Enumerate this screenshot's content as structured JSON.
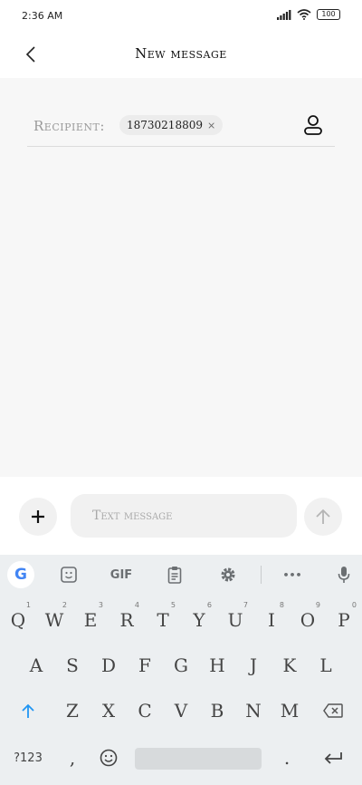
{
  "status_bar": {
    "time": "2:36 AM",
    "battery": "100"
  },
  "header": {
    "title": "New message"
  },
  "recipient": {
    "label": "Recipient:",
    "chip_text": "18730218809",
    "chip_remove": "×"
  },
  "compose": {
    "placeholder": "Text message"
  },
  "keyboard": {
    "toolbar": {
      "google": "G",
      "gif": "GIF",
      "more": "•••"
    },
    "row1": [
      {
        "k": "Q",
        "h": "1"
      },
      {
        "k": "W",
        "h": "2"
      },
      {
        "k": "E",
        "h": "3"
      },
      {
        "k": "R",
        "h": "4"
      },
      {
        "k": "T",
        "h": "5"
      },
      {
        "k": "Y",
        "h": "6"
      },
      {
        "k": "U",
        "h": "7"
      },
      {
        "k": "I",
        "h": "8"
      },
      {
        "k": "O",
        "h": "9"
      },
      {
        "k": "P",
        "h": "0"
      }
    ],
    "row2": [
      "A",
      "S",
      "D",
      "F",
      "G",
      "H",
      "J",
      "K",
      "L"
    ],
    "row3": [
      "Z",
      "X",
      "C",
      "V",
      "B",
      "N",
      "M"
    ],
    "symbols_label": "?123",
    "comma": ",",
    "period": "."
  },
  "colors": {
    "accent": "#2196f3",
    "background": "#f7f7f7",
    "keyboard_bg": "#eceff1"
  }
}
